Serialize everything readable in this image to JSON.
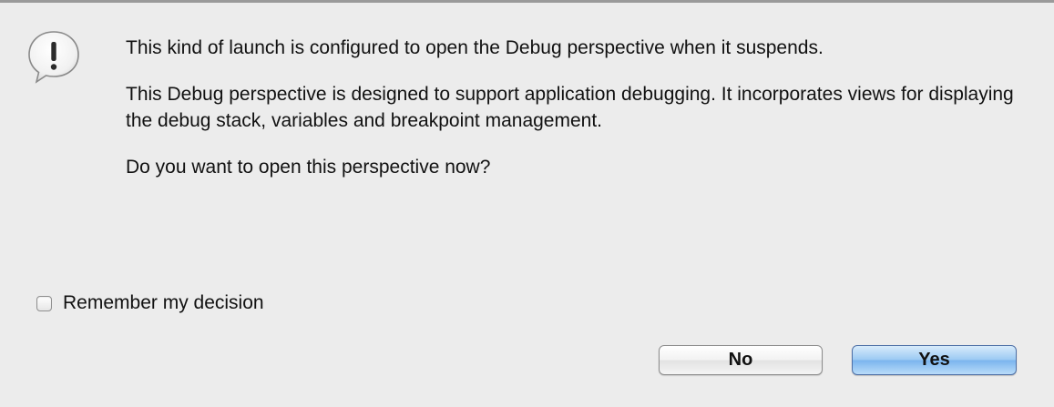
{
  "dialog": {
    "icon": "warning-speech-bubble-icon",
    "message": {
      "line1": "This kind of launch is configured to open the Debug perspective when it suspends.",
      "line2": "This Debug perspective is designed to support application debugging.  It incorporates views for displaying the debug stack, variables and breakpoint management.",
      "question": "Do you want to open this perspective now?"
    },
    "remember": {
      "label": "Remember my decision",
      "checked": false
    },
    "buttons": {
      "no": "No",
      "yes": "Yes"
    },
    "colors": {
      "background": "#ececec",
      "default_button": "#7bb5ee"
    }
  }
}
